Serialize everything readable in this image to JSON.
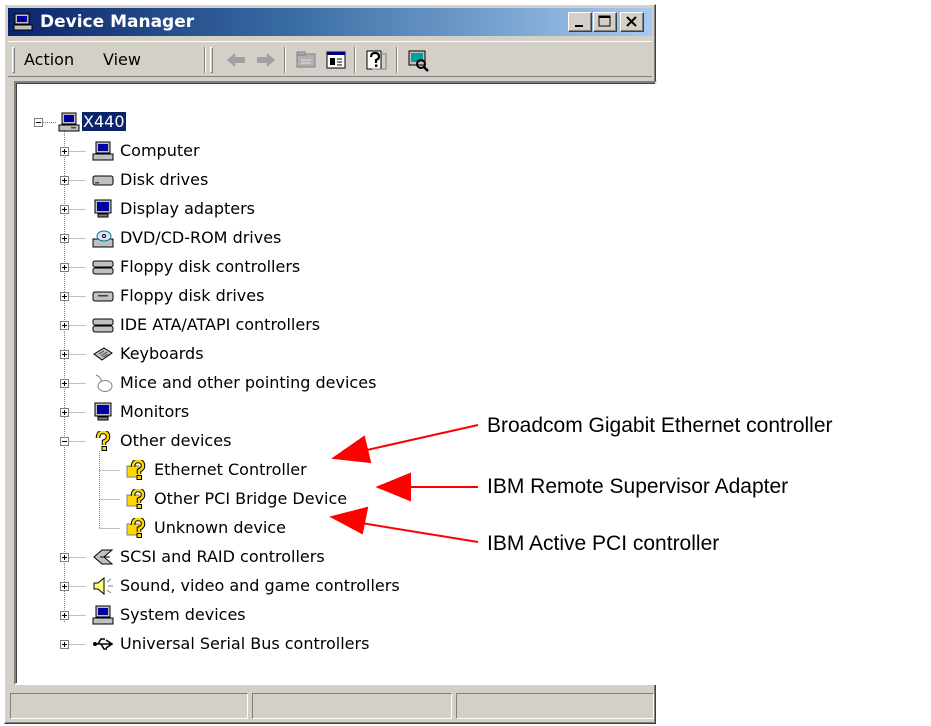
{
  "window": {
    "title": "Device Manager",
    "controls": {
      "minimize": "minimize",
      "maximize": "maximize",
      "close": "close"
    }
  },
  "toolbar": {
    "menus": [
      "Action",
      "View"
    ],
    "buttons": [
      "back-arrow-icon",
      "forward-arrow-icon",
      "up-folder-icon",
      "properties-icon",
      "help-icon",
      "scan-hardware-icon"
    ]
  },
  "tree": {
    "root": "X440",
    "categories": [
      "Computer",
      "Disk drives",
      "Display adapters",
      "DVD/CD-ROM drives",
      "Floppy disk controllers",
      "Floppy disk drives",
      "IDE ATA/ATAPI controllers",
      "Keyboards",
      "Mice and other pointing devices",
      "Monitors",
      "Other devices"
    ],
    "other_devices": [
      "Ethernet Controller",
      "Other PCI Bridge Device",
      "Unknown device"
    ],
    "categories_after": [
      "SCSI and RAID controllers",
      "Sound, video and game controllers",
      "System devices",
      "Universal Serial Bus controllers"
    ]
  },
  "annotations": [
    "Broadcom Gigabit Ethernet controller",
    "IBM Remote Supervisor Adapter",
    "IBM Active PCI controller"
  ],
  "colors": {
    "title_active": "#0a246a",
    "face": "#d4d0c8",
    "selection": "#0a246a",
    "arrow": "#ff0000",
    "warning": "#ffd700"
  }
}
